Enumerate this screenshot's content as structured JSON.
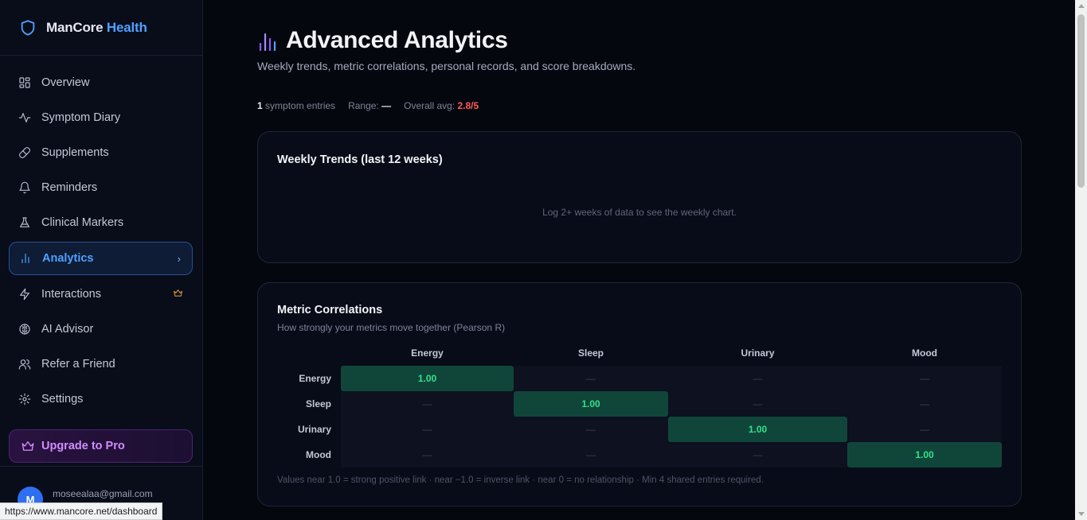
{
  "brand": {
    "name": "ManCore",
    "accent": "Health"
  },
  "sidebar": {
    "items": [
      {
        "label": "Overview",
        "icon": "grid-icon"
      },
      {
        "label": "Symptom Diary",
        "icon": "activity-icon"
      },
      {
        "label": "Supplements",
        "icon": "pill-icon"
      },
      {
        "label": "Reminders",
        "icon": "bell-icon"
      },
      {
        "label": "Clinical Markers",
        "icon": "flask-icon"
      },
      {
        "label": "Analytics",
        "icon": "bar-chart-icon",
        "active": true,
        "chevron": "›"
      },
      {
        "label": "Interactions",
        "icon": "zap-icon",
        "badge": "crown-icon"
      },
      {
        "label": "AI Advisor",
        "icon": "brain-icon"
      },
      {
        "label": "Refer a Friend",
        "icon": "users-icon"
      },
      {
        "label": "Settings",
        "icon": "gear-icon"
      }
    ],
    "upgrade_label": "Upgrade to Pro",
    "user": {
      "initial": "M",
      "email": "moseealaa@gmail.com"
    }
  },
  "status_url": "https://www.mancore.net/dashboard",
  "main": {
    "title": "Advanced Analytics",
    "subtitle": "Weekly trends, metric correlations, personal records, and score breakdowns.",
    "stats": {
      "entries_count": "1",
      "entries_label": "symptom entries",
      "range_label": "Range:",
      "range_value": "—",
      "avg_label": "Overall avg:",
      "avg_value": "2.8/5"
    },
    "weekly": {
      "title": "Weekly Trends (last 12 weeks)",
      "empty_message": "Log 2+ weeks of data to see the weekly chart."
    },
    "correlations": {
      "title": "Metric Correlations",
      "subtitle": "How strongly your metrics move together (Pearson R)",
      "metrics": [
        "Energy",
        "Sleep",
        "Urinary",
        "Mood"
      ],
      "matrix": [
        [
          "1.00",
          "—",
          "—",
          "—"
        ],
        [
          "—",
          "1.00",
          "—",
          "—"
        ],
        [
          "—",
          "—",
          "1.00",
          "—"
        ],
        [
          "—",
          "—",
          "—",
          "1.00"
        ]
      ],
      "note": "Values near 1.0 = strong positive link · near −1.0 = inverse link · near 0 = no relationship · Min 4 shared entries required."
    }
  },
  "colors": {
    "accent": "#4ea1ff",
    "pro": "#d38cff",
    "positive": "#33e08a",
    "avg_alert": "#ff5a5a"
  }
}
